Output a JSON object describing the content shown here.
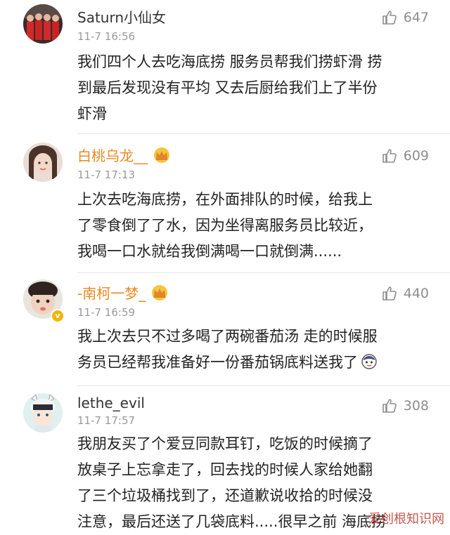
{
  "comments": [
    {
      "username": "Saturn小仙女",
      "time": "11-7 16:56",
      "likes": "647",
      "vip": false,
      "lines": [
        "我们四个人去吃海底捞 服务员帮我们捞虾滑  捞",
        "到最后发现没有平均 又去后厨给我们上了半份",
        "虾滑"
      ]
    },
    {
      "username": "白桃乌龙__",
      "time": "11-7 17:13",
      "likes": "609",
      "vip": true,
      "lines": [
        "上次去吃海底捞，在外面排队的时候，给我上",
        "了零食倒了了水，因为坐得离服务员比较近，",
        "我喝一口水就给我倒满喝一口就倒满......"
      ]
    },
    {
      "username": "-南柯一梦_",
      "time": "11-7 16:59",
      "likes": "440",
      "vip": true,
      "lines": [
        "我上次去只不过多喝了两碗番茄汤 走的时候服",
        "务员已经帮我准备好一份番茄锅底料送我了"
      ]
    },
    {
      "username": "lethe_evil",
      "time": "11-7 17:57",
      "likes": "308",
      "vip": false,
      "lines": [
        "我朋友买了个爱豆同款耳钉，吃饭的时候摘了",
        "放桌子上忘拿走了，回去找的时候人家给她翻",
        "了三个垃圾桶找到了，还道歉说收拾的时候没",
        "注意，最后还送了几袋底料.....很早之前 海底捞"
      ]
    }
  ],
  "icons": {
    "like": "thumbs-up-icon",
    "crown": "crown-badge-icon",
    "verified": "verified-v-icon"
  },
  "colors": {
    "vip_name": "#e8891f",
    "time": "#9a9a9a",
    "like": "#8d8d8d"
  },
  "watermark": "爱创根知识网"
}
